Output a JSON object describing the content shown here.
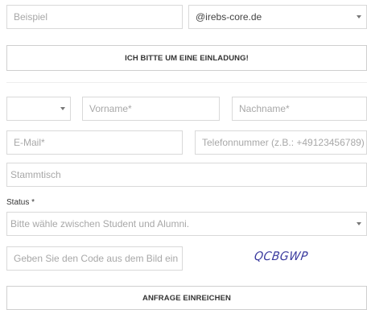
{
  "invite": {
    "example_placeholder": "Beispiel",
    "domain_value": "@irebs-core.de",
    "request_invite_button": "ICH BITTE UM EINE EINLADUNG!"
  },
  "form": {
    "salutation_value": "",
    "firstname_placeholder": "Vorname*",
    "lastname_placeholder": "Nachname*",
    "email_placeholder": "E-Mail*",
    "phone_placeholder": "Telefonnummer (z.B.: +49123456789)",
    "stammtisch_placeholder": "Stammtisch",
    "status_label": "Status *",
    "status_value": "Bitte wähle zwischen Student und Alumni.",
    "captcha_placeholder": "Geben Sie den Code aus dem Bild ein",
    "captcha_text": "QCBGWP",
    "submit_button": "ANFRAGE EINREICHEN"
  },
  "colors": {
    "border": "#d9d9d9",
    "captcha": "#3a3a9e"
  }
}
